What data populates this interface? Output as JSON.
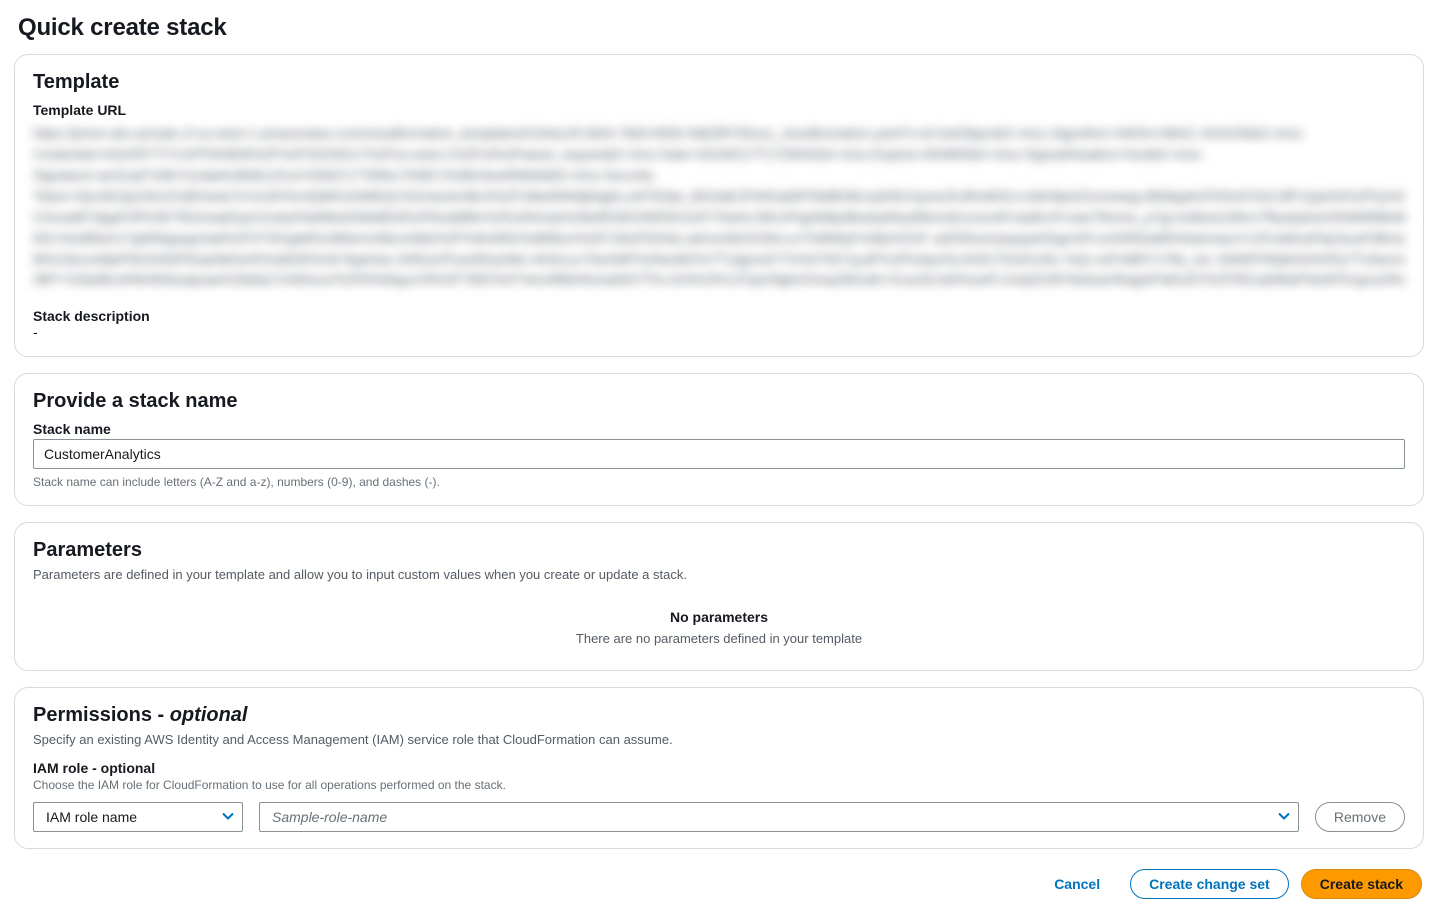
{
  "page": {
    "title": "Quick create stack"
  },
  "template": {
    "heading": "Template",
    "url_label": "Template URL",
    "desc_label": "Stack description",
    "desc_value": "-"
  },
  "stack": {
    "heading": "Provide a stack name",
    "name_label": "Stack name",
    "name_value": "CustomerAnalytics",
    "name_hint": "Stack name can include letters (A-Z and a-z), numbers (0-9), and dashes (-)."
  },
  "parameters": {
    "heading": "Parameters",
    "sub": "Parameters are defined in your template and allow you to input custom values when you create or update a stack.",
    "empty_title": "No parameters",
    "empty_sub": "There are no parameters defined in your template"
  },
  "permissions": {
    "heading_main": "Permissions - ",
    "heading_optional": "optional",
    "sub": "Specify an existing AWS Identity and Access Management (IAM) service role that CloudFormation can assume.",
    "role_label": "IAM role - optional",
    "role_hint": "Choose the IAM role for CloudFormation to use for all operations performed on the stack.",
    "role_select": "IAM role name",
    "sample_placeholder": "Sample-role-name",
    "remove_label": "Remove"
  },
  "footer": {
    "cancel": "Cancel",
    "change_set": "Create change set",
    "create": "Create stack"
  },
  "colors": {
    "link": "#0073bb",
    "primary": "#ff9900"
  }
}
